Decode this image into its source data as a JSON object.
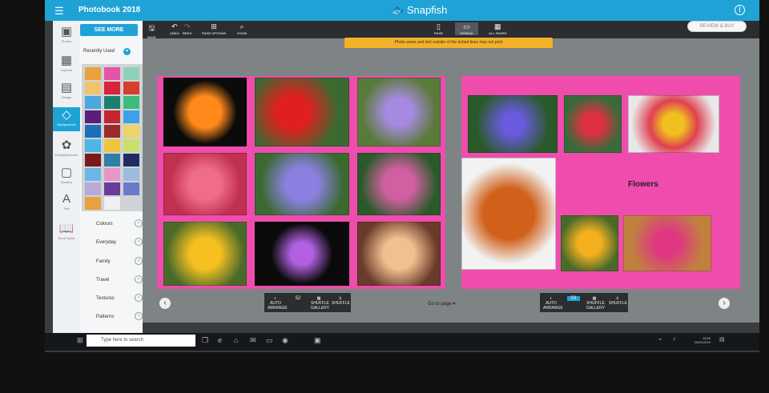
{
  "app": {
    "title": "Photobook 2018",
    "brand": "Snapfish",
    "brand_color": "#1fa3d6"
  },
  "sidebar": {
    "see_more": "SEE MORE",
    "recently_used": "Recently Used",
    "categories": [
      "Colours",
      "Everyday",
      "Family",
      "Travel",
      "Textures",
      "Patterns"
    ]
  },
  "icon_nav": [
    {
      "icon": "photos-icon",
      "label": "Photos"
    },
    {
      "icon": "layouts-icon",
      "label": "Layouts"
    },
    {
      "icon": "design-icon",
      "label": "Design"
    },
    {
      "icon": "backgrounds-icon",
      "label": "Backgrounds"
    },
    {
      "icon": "embellishments-icon",
      "label": "Embellishments"
    },
    {
      "icon": "borders-icon",
      "label": "Borders"
    },
    {
      "icon": "text-icon",
      "label": "Text"
    },
    {
      "icon": "book-icon",
      "label": "Book Spine"
    }
  ],
  "swatches": [
    "#e8a23a",
    "#e455a8",
    "#8fd0b8",
    "#f2c46a",
    "#d8233a",
    "#d63f2d",
    "#4aa8e0",
    "#1f7f6f",
    "#3bbd7a",
    "#5b1e7a",
    "#c72532",
    "#3da0e8",
    "#1c6fb4",
    "#9b2b2b",
    "#f0d26a",
    "#4db6e4",
    "#f2c43d",
    "#c9e06a",
    "#7a1a1a",
    "#2f7fa6",
    "#202b62",
    "#6bb6e8",
    "#e896c8",
    "#9bbbe0",
    "#b9a9d8",
    "#6a3c9c",
    "#6a7cc8",
    "#e8a040",
    "#f0f0f0"
  ],
  "toolbar": {
    "save": "SAVE",
    "undo": "UNDO",
    "redo": "REDO",
    "page_options": "PAGE OPTIONS",
    "zoom": "ZOOM",
    "page": "PAGE",
    "spread": "SPREAD",
    "all_pages": "ALL PAGES",
    "review_buy": "REVIEW & BUY"
  },
  "warning": "Photo areas and text outside of the dotted lines may not print",
  "spread": {
    "title_text": "Flowers",
    "goto_page": "Go to page",
    "left_controls": {
      "auto_arrange": "AUTO ARRANGE",
      "count": "52",
      "shuffle_gallery": "SHUFFLE GALLERY",
      "shuffle": "SHUFFLE"
    },
    "right_controls": {
      "auto_arrange": "AUTO ARRANGE",
      "count": "53",
      "shuffle_gallery": "SHUFFLE GALLERY",
      "shuffle": "SHUFFLE"
    }
  },
  "taskbar": {
    "search_placeholder": "Type here to search",
    "time": "15:02",
    "date": "26/01/2019"
  }
}
